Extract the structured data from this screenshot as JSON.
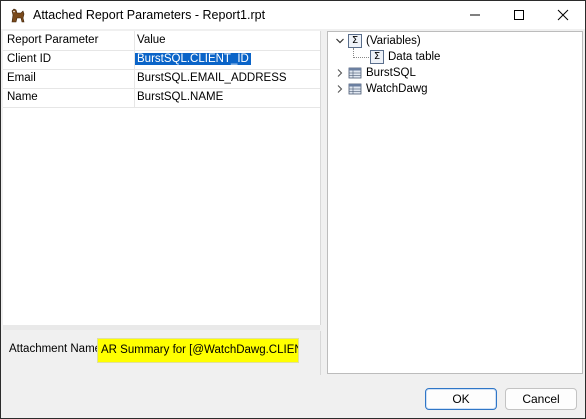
{
  "window": {
    "title": "Attached Report Parameters - Report1.rpt"
  },
  "grid": {
    "headers": [
      "Report Parameter",
      "Value"
    ],
    "rows": [
      {
        "param": "Client ID",
        "value": "BurstSQL.CLIENT_ID",
        "selected": true
      },
      {
        "param": "Email",
        "value": "BurstSQL.EMAIL_ADDRESS"
      },
      {
        "param": "Name",
        "value": "BurstSQL.NAME"
      }
    ]
  },
  "attachment": {
    "label": "Attachment Name",
    "value": "AR Summary for [@WatchDawg.CLIENT_"
  },
  "tree": {
    "nodes": [
      {
        "label": "(Variables)",
        "icon": "sigma-icon",
        "expanded": true
      },
      {
        "label": "Data table",
        "icon": "sigma-icon",
        "child": true
      },
      {
        "label": "BurstSQL",
        "icon": "database-table-icon",
        "expanded": false
      },
      {
        "label": "WatchDawg",
        "icon": "database-table-icon",
        "expanded": false
      }
    ]
  },
  "buttons": {
    "ok": "OK",
    "cancel": "Cancel"
  },
  "colors": {
    "selection": "#0a64c8",
    "highlight": "#ffff00",
    "ok_border": "#2f76c7"
  }
}
